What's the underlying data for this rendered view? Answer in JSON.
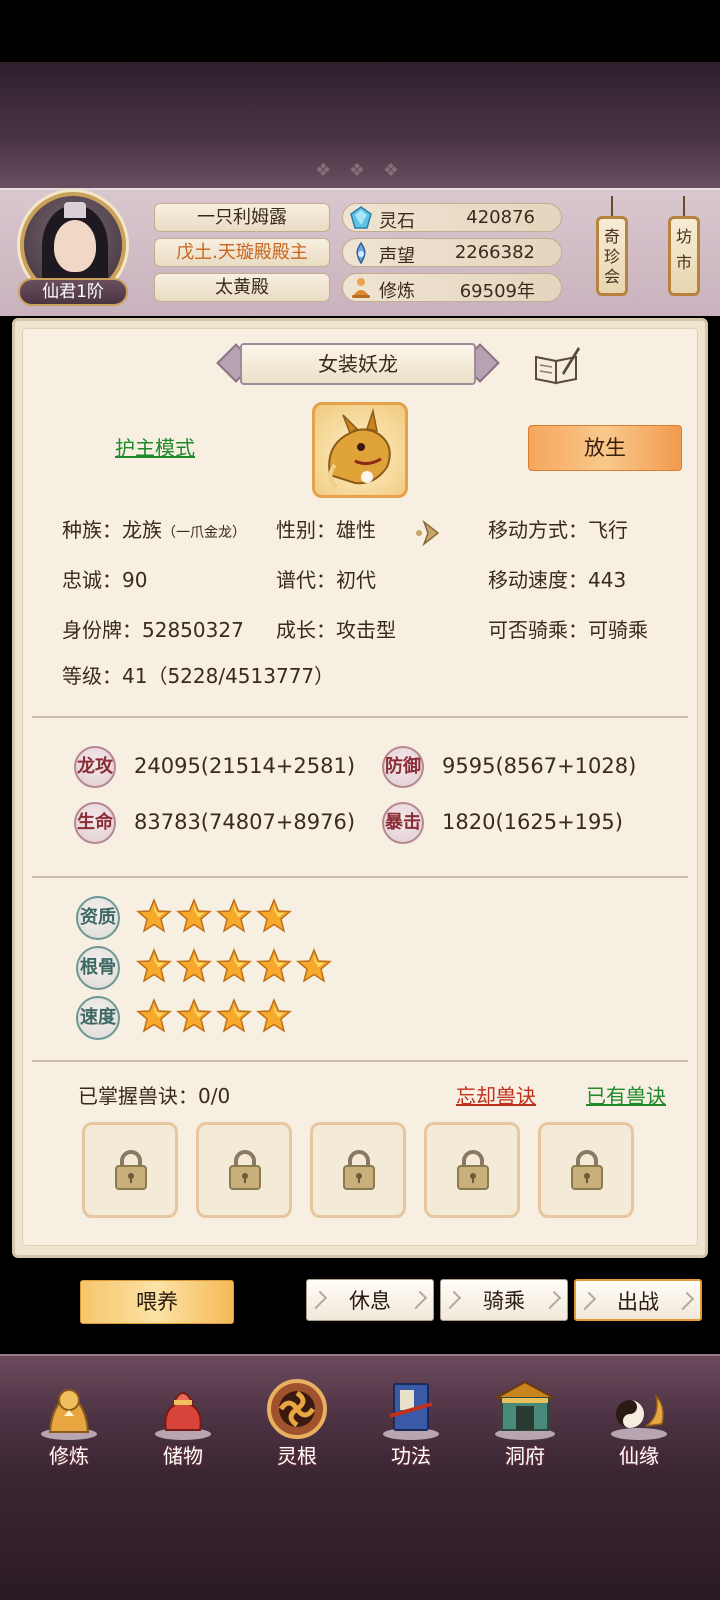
{
  "header": {
    "player_name": "一只利姆露",
    "player_title": "戊土.天璇殿殿主",
    "sect": "太黄殿",
    "rank": "仙君1阶",
    "resources": [
      {
        "icon": "spirit-stone-icon",
        "label": "灵石",
        "value": "420876"
      },
      {
        "icon": "prestige-icon",
        "label": "声望",
        "value": "2266382"
      },
      {
        "icon": "cultivation-icon",
        "label": "修炼",
        "value": "69509年"
      }
    ],
    "lanterns": [
      {
        "label_lines": [
          "奇",
          "珍",
          "会"
        ]
      },
      {
        "label_lines": [
          "坊",
          "市"
        ]
      }
    ]
  },
  "pet": {
    "name": "女装妖龙",
    "guard_mode": "护主模式",
    "release": "放生",
    "info": {
      "race_label": "种族：",
      "race_value": "龙族",
      "race_sub": "（一爪金龙）",
      "gender_label": "性别：",
      "gender_value": "雄性",
      "move_type_label": "移动方式：",
      "move_type_value": "飞行",
      "loyalty_label": "忠诚：",
      "loyalty_value": "90",
      "gen_label": "谱代：",
      "gen_value": "初代",
      "move_speed_label": "移动速度：",
      "move_speed_value": "443",
      "id_label": "身份牌：",
      "id_value": "52850327",
      "growth_label": "成长：",
      "growth_value": "攻击型",
      "rideable_label": "可否骑乘：",
      "rideable_value": "可骑乘",
      "level_label": "等级：",
      "level_value": "41（5228/4513777）"
    },
    "stats": [
      {
        "label": "龙攻",
        "value": "24095(21514+2581)"
      },
      {
        "label": "防御",
        "value": "9595(8567+1028)"
      },
      {
        "label": "生命",
        "value": "83783(74807+8976)"
      },
      {
        "label": "暴击",
        "value": "1820(1625+195)"
      }
    ],
    "aptitudes": [
      {
        "label": "资质",
        "stars": 4
      },
      {
        "label": "根骨",
        "stars": 5
      },
      {
        "label": "速度",
        "stars": 4
      }
    ],
    "skills": {
      "mastered": "已掌握兽诀：0/0",
      "forget": "忘却兽诀",
      "owned": "已有兽诀",
      "slots": 5
    }
  },
  "actions": {
    "feed": "喂养",
    "rest": "休息",
    "ride": "骑乘",
    "battle": "出战"
  },
  "nav": [
    {
      "label": "修炼",
      "icon": "cultivate-icon"
    },
    {
      "label": "储物",
      "icon": "storage-bag-icon"
    },
    {
      "label": "灵根",
      "icon": "spirit-root-icon"
    },
    {
      "label": "功法",
      "icon": "technique-book-icon"
    },
    {
      "label": "洞府",
      "icon": "cave-mansion-icon"
    },
    {
      "label": "仙缘",
      "icon": "fate-icon"
    }
  ],
  "colors": {
    "accent_orange": "#f6a55c",
    "guard_green": "#1f8a2a",
    "forget_red": "#c0301c",
    "title_orange": "#c8641e"
  }
}
